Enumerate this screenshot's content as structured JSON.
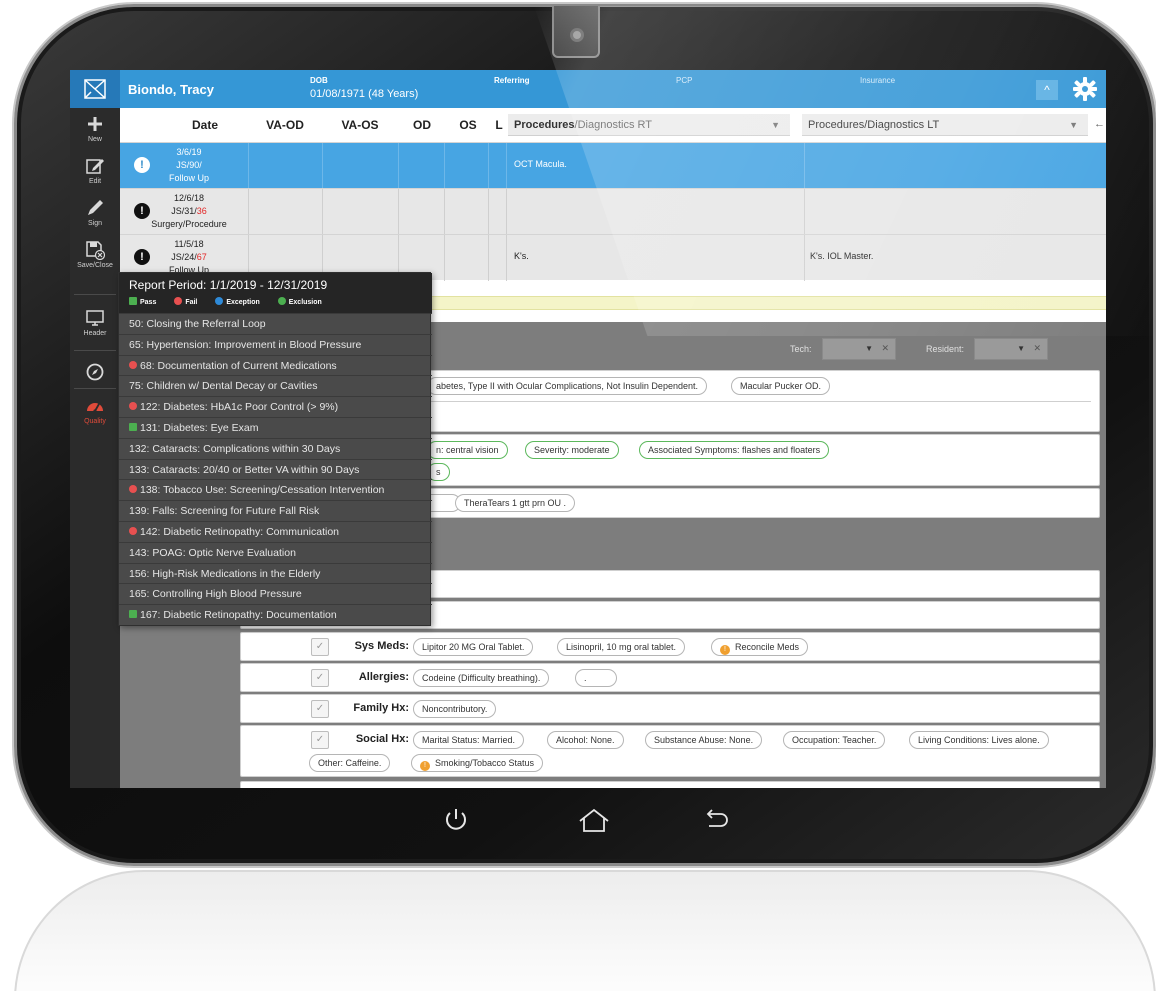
{
  "header": {
    "patient_name": "Biondo, Tracy",
    "dob_label": "DOB",
    "dob_value": "01/08/1971 (48 Years)",
    "referring_label": "Referring",
    "pcp_label": "PCP",
    "insurance_label": "Insurance",
    "collapse_glyph": "^"
  },
  "sidebar": {
    "items": [
      {
        "label": "New",
        "icon": "plus-icon"
      },
      {
        "label": "Edit",
        "icon": "edit-icon"
      },
      {
        "label": "Sign",
        "icon": "pen-icon"
      },
      {
        "label": "Save/Close",
        "icon": "save-close-icon"
      },
      {
        "label": "Header",
        "icon": "monitor-icon"
      },
      {
        "label": "",
        "icon": "compass-icon"
      },
      {
        "label": "Quality",
        "icon": "gauge-icon"
      }
    ]
  },
  "visits": {
    "columns": [
      "Date",
      "VA-OD",
      "VA-OS",
      "OD",
      "OS",
      "L"
    ],
    "proc_rt_bold": "Procedures",
    "proc_rt_rest": "/Diagnostics RT",
    "proc_lt": "Procedures/Diagnostics LT",
    "rows": [
      {
        "date": "3/6/19",
        "code_a": "JS/90/",
        "code_b": "",
        "type": "Follow Up",
        "proc_rt": "OCT Macula.",
        "proc_lt": ""
      },
      {
        "date": "12/6/18",
        "code_a": "JS/31/",
        "code_b": "36",
        "type": "Surgery/Procedure",
        "proc_rt": "",
        "proc_lt": ""
      },
      {
        "date": "11/5/18",
        "code_a": "JS/24/",
        "code_b": "67",
        "type": "Follow Up",
        "proc_rt": "K's.",
        "proc_lt": "K's. IOL Master."
      }
    ]
  },
  "exam": {
    "tech_label": "Tech:",
    "resident_label": "Resident:",
    "dx_chips": [
      "abetes, Type II with Ocular Complications, Not Insulin Dependent.",
      "Macular Pucker OD."
    ],
    "hpi_chips": [
      "n: central vision",
      "Severity: moderate",
      "Associated Symptoms: flashes and floaters"
    ],
    "hpi_chip2": "s",
    "meds_chips": [
      "TheraTears 1 gtt prn OU ."
    ],
    "sys_meds": {
      "label": "Sys Meds:",
      "chips": [
        "Lipitor 20 MG Oral Tablet.",
        "Lisinopril, 10 mg oral tablet."
      ],
      "action": "Reconcile Meds"
    },
    "allergies": {
      "label": "Allergies:",
      "chips": [
        "Codeine (Difficulty breathing).",
        "."
      ]
    },
    "family_hx": {
      "label": "Family Hx:",
      "chips": [
        "Noncontributory."
      ]
    },
    "social_hx": {
      "label": "Social Hx:",
      "chips": [
        "Marital Status: Married.",
        "Alcohol: None.",
        "Substance Abuse: None.",
        "Occupation: Teacher.",
        "Living Conditions: Lives alone."
      ],
      "chips2": [
        "Other: Caffeine."
      ],
      "action": "Smoking/Tobacco Status"
    }
  },
  "quality": {
    "title": "Report Period: 1/1/2019 - 12/31/2019",
    "legend": {
      "pass": "Pass",
      "fail": "Fail",
      "exception": "Exception",
      "exclusion": "Exclusion"
    },
    "measures": [
      {
        "label": "50: Closing the Referral Loop",
        "status": ""
      },
      {
        "label": "65: Hypertension: Improvement in Blood Pressure",
        "status": ""
      },
      {
        "label": "68: Documentation of Current Medications",
        "status": "fail"
      },
      {
        "label": "75: Children w/ Dental Decay or Cavities",
        "status": ""
      },
      {
        "label": "122: Diabetes: HbA1c Poor Control (> 9%)",
        "status": "fail"
      },
      {
        "label": "131: Diabetes: Eye Exam",
        "status": "pass"
      },
      {
        "label": "132: Cataracts: Complications within 30 Days",
        "status": ""
      },
      {
        "label": "133: Cataracts: 20/40 or Better VA within 90 Days",
        "status": ""
      },
      {
        "label": "138: Tobacco Use: Screening/Cessation Intervention",
        "status": "fail"
      },
      {
        "label": "139: Falls: Screening for Future Fall Risk",
        "status": ""
      },
      {
        "label": "142: Diabetic Retinopathy: Communication",
        "status": "fail"
      },
      {
        "label": "143: POAG: Optic Nerve Evaluation",
        "status": ""
      },
      {
        "label": "156: High-Risk Medications in the Elderly",
        "status": ""
      },
      {
        "label": "165: Controlling High Blood Pressure",
        "status": ""
      },
      {
        "label": "167: Diabetic Retinopathy: Documentation",
        "status": "pass"
      }
    ]
  },
  "colors": {
    "header_blue": "#3597d6",
    "selected_row": "#47a5e3",
    "fail": "#e85050",
    "pass": "#4caf50",
    "accent_orange": "#f0a030"
  }
}
